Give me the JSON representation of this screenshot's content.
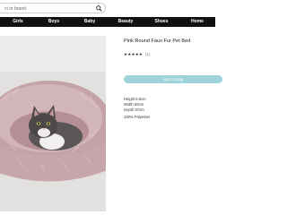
{
  "search": {
    "placeholder": "ct or brand"
  },
  "nav": [
    "Girls",
    "Boys",
    "Baby",
    "Beauty",
    "Shoes",
    "Home"
  ],
  "product": {
    "title": "Pink Round Faux Fur Pet Bed",
    "rating_stars": "★★★★★",
    "review_count": "(1)",
    "add_to_bag_label": "Add to Bag",
    "height": "Height 8.6cm",
    "width": "Width 50cm",
    "depth": "Depth 37cm",
    "material": "100% Polyester"
  },
  "colors": {
    "nav_background": "#111111",
    "button_accent": "#9fd3da",
    "bed_pink": "#c9a9ae"
  },
  "icons": [
    "search-icon"
  ]
}
